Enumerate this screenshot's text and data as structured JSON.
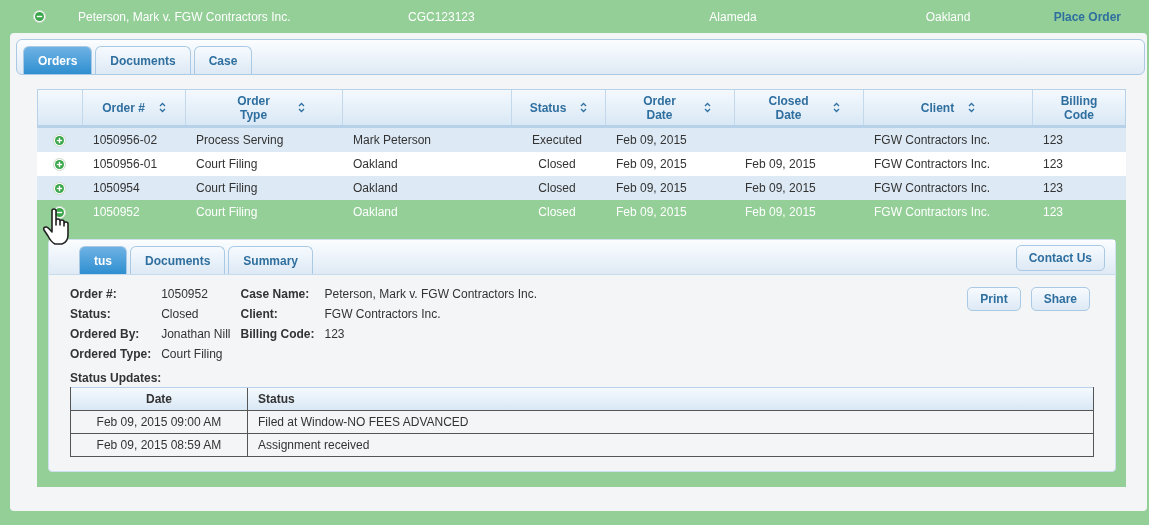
{
  "case_bar": {
    "expanded": true,
    "case_name": "Peterson, Mark v. FGW Contractors Inc.",
    "case_number": "CGC123123",
    "county": "Alameda",
    "city": "Oakland",
    "action": "Place Order"
  },
  "tabs": [
    {
      "label": "Orders",
      "selected": true
    },
    {
      "label": "Documents",
      "selected": false
    },
    {
      "label": "Case",
      "selected": false
    }
  ],
  "table": {
    "columns": [
      {
        "label": "Order #",
        "sortable": true
      },
      {
        "label": "Order Type",
        "sortable": true
      },
      {
        "sortable": false
      },
      {
        "label": "Status",
        "sortable": true
      },
      {
        "label": "Order Date",
        "sortable": true
      },
      {
        "label": "Closed Date",
        "sortable": true
      },
      {
        "label": "Client",
        "sortable": true
      },
      {
        "label": "Billing Code",
        "sortable": false
      }
    ],
    "rows": [
      {
        "expanded": false,
        "selected": false,
        "cells": [
          "1050956-02",
          "Process Serving",
          "Mark Peterson",
          "Executed",
          "Feb 09, 2015",
          "",
          "FGW Contractors Inc.",
          "123"
        ]
      },
      {
        "expanded": false,
        "selected": false,
        "cells": [
          "1050956-01",
          "Court Filing",
          "Oakland",
          "Closed",
          "Feb 09, 2015",
          "Feb 09, 2015",
          "FGW Contractors Inc.",
          "123"
        ]
      },
      {
        "expanded": false,
        "selected": false,
        "cells": [
          "1050954",
          "Court Filing",
          "Oakland",
          "Closed",
          "Feb 09, 2015",
          "Feb 09, 2015",
          "FGW Contractors Inc.",
          "123"
        ]
      },
      {
        "expanded": true,
        "selected": true,
        "cells": [
          "1050952",
          "Court Filing",
          "Oakland",
          "Closed",
          "Feb 09, 2015",
          "Feb 09, 2015",
          "FGW Contractors Inc.",
          "123"
        ]
      }
    ]
  },
  "detail": {
    "tabs": [
      {
        "label": "tus",
        "selected": true
      },
      {
        "label": "Documents",
        "selected": false
      },
      {
        "label": "Summary",
        "selected": false
      }
    ],
    "contact_button": "Contact Us",
    "fields_left": [
      {
        "label": "Order #:",
        "value": "1050952"
      },
      {
        "label": "Status:",
        "value": "Closed"
      },
      {
        "label": "Ordered By:",
        "value": "Jonathan Nill"
      },
      {
        "label": "Ordered Type:",
        "value": "Court Filing"
      }
    ],
    "fields_right": [
      {
        "label": "Case Name:",
        "value": "Peterson, Mark v. FGW Contractors Inc."
      },
      {
        "label": "Client:",
        "value": "FGW Contractors Inc."
      },
      {
        "label": "Billing Code:",
        "value": "123"
      }
    ],
    "buttons": [
      "Print",
      "Share"
    ],
    "updates_label": "Status Updates:",
    "updates": {
      "columns": [
        "Date",
        "Status"
      ],
      "rows": [
        [
          "Feb 09, 2015 09:00 AM",
          "Filed at Window-NO FEES ADVANCED"
        ],
        [
          "Feb 09, 2015 08:59 AM",
          "Assignment received"
        ]
      ]
    }
  }
}
